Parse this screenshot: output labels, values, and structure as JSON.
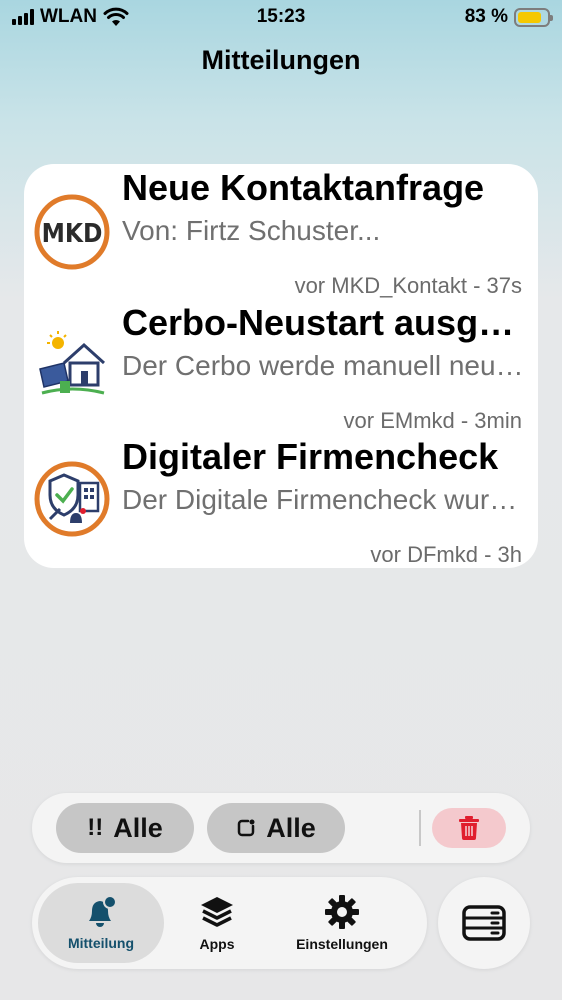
{
  "status_bar": {
    "carrier": "WLAN",
    "time": "15:23",
    "battery_percent": "83 %",
    "battery_level": 0.83
  },
  "header": {
    "title": "Mitteilungen"
  },
  "notifications": [
    {
      "icon": "mkd-logo-icon",
      "icon_text": "MKD",
      "title": "Neue Kontaktanfrage",
      "body": "Von: Firtz Schuster...",
      "meta": "vor MKD_Kontakt - 37s"
    },
    {
      "icon": "solar-house-icon",
      "title": "Cerbo-Neustart ausgelöst",
      "body": "Der Cerbo werde manuell neu gestartet",
      "meta": "vor EMmkd - 3min"
    },
    {
      "icon": "security-check-icon",
      "title": "Digitaler Firmencheck",
      "body": "Der Digitale Firmencheck wurde durchgeführt",
      "meta": "vor DFmkd - 3h"
    }
  ],
  "filters": {
    "priority": {
      "glyph": "!!",
      "label": "Alle"
    },
    "status": {
      "glyph": "◻",
      "label": "Alle"
    }
  },
  "tabs": [
    {
      "label": "Mitteilung",
      "icon": "bell-badge-icon",
      "active": true
    },
    {
      "label": "Apps",
      "icon": "layers-icon"
    },
    {
      "label": "Einstellungen",
      "icon": "gear-icon"
    }
  ],
  "colors": {
    "accent": "#14506c",
    "delete_bg": "#f4c9cd",
    "delete_icon": "#e01e2e",
    "mkd_orange": "#e07b2a",
    "battery": "#f5c800"
  }
}
